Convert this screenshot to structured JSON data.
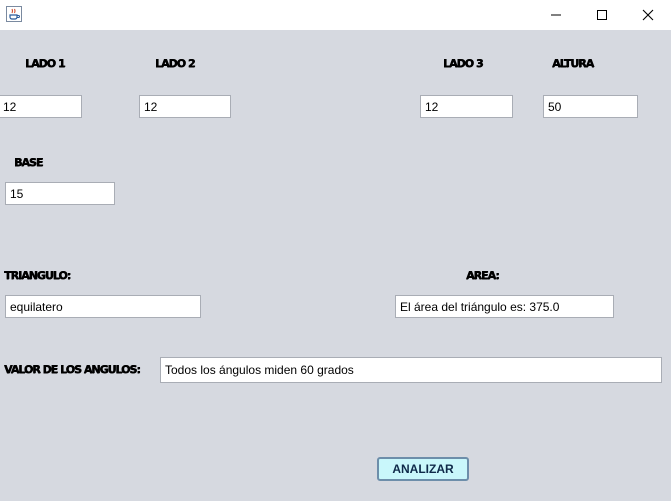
{
  "window": {
    "icon": "java-cup-icon",
    "controls": {
      "minimize": "minimize-icon",
      "maximize": "maximize-icon",
      "close": "close-icon"
    }
  },
  "labels": {
    "lado1": "LADO 1",
    "lado2": "LADO 2",
    "lado3": "LADO 3",
    "altura": "ALTURA",
    "base": "BASE",
    "triangulo": "TRIANGULO:",
    "area": "AREA:",
    "angulos": "VALOR DE LOS ANGULOS:"
  },
  "fields": {
    "lado1": "12",
    "lado2": "12",
    "lado3": "12",
    "altura": "50",
    "base": "15",
    "triangulo": "equilatero",
    "area": "El área del triángulo es: 375.0",
    "angulos": "Todos los ángulos miden 60 grados"
  },
  "button": {
    "analizar": "ANALIZAR"
  },
  "colors": {
    "background": "#d6d9e0",
    "button_fill": "#c9f7fb",
    "button_border": "#6d8eaa"
  }
}
